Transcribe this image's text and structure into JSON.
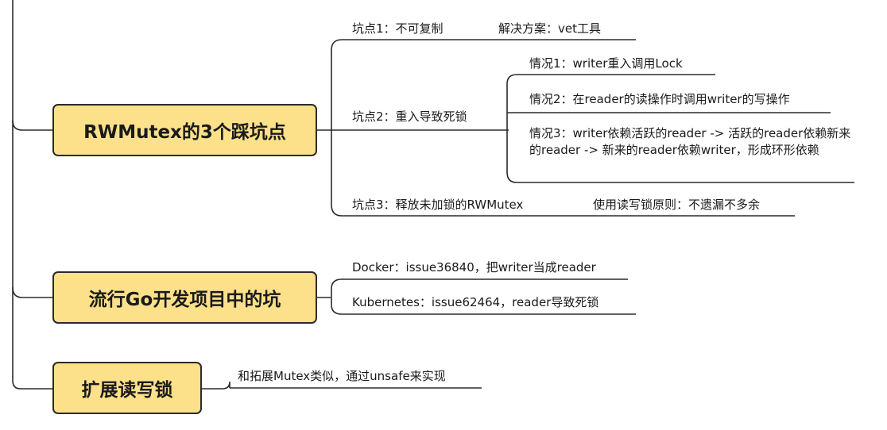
{
  "nodes": {
    "rwmutex": {
      "label": "RWMutex的3个踩坑点",
      "pit1": {
        "label": "坑点1：不可复制",
        "solution": "解决方案：vet工具"
      },
      "pit2": {
        "label": "坑点2：重入导致死锁",
        "case1": "情况1：writer重入调用Lock",
        "case2": "情况2：在reader的读操作时调用writer的写操作",
        "case3": "情况3：writer依赖活跃的reader -> 活跃的reader依赖新来的reader -> 新来的reader依赖writer，形成环形依赖"
      },
      "pit3": {
        "label": "坑点3：释放未加锁的RWMutex",
        "principle": "使用读写锁原则：不遗漏不多余"
      }
    },
    "projects": {
      "label": "流行Go开发项目中的坑",
      "docker": "Docker：issue36840，把writer当成reader",
      "kubernetes": "Kubernetes：issue62464，reader导致死锁"
    },
    "extend": {
      "label": "扩展读写锁",
      "desc": "和拓展Mutex类似，通过unsafe来实现"
    }
  }
}
